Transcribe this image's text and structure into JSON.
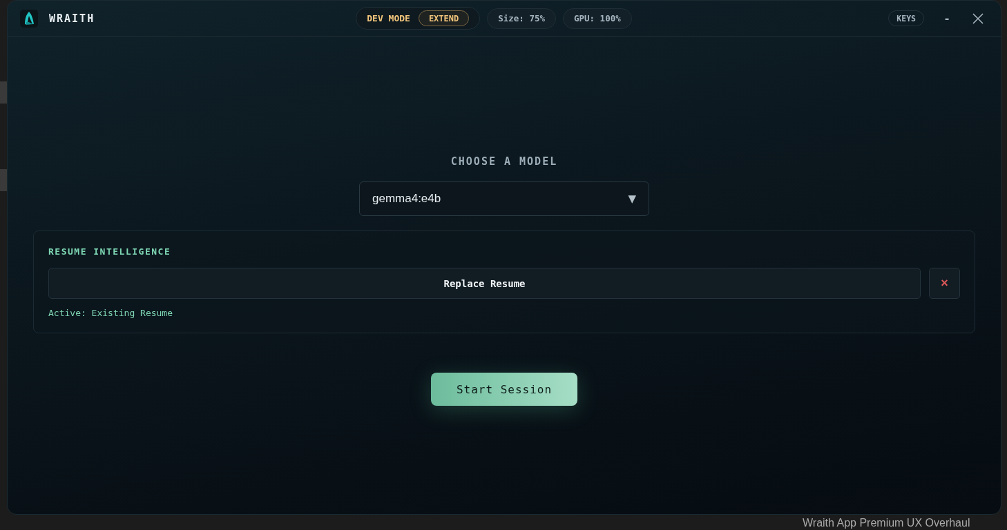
{
  "backdrop": {
    "bottom_title": "Wraith App Premium UX Overhaul"
  },
  "window": {
    "title": "WRAITH",
    "dev_mode": {
      "label": "DEV MODE",
      "button": "EXTEND"
    },
    "stats": [
      "Size: 75%",
      "GPU: 100%"
    ],
    "controls": {
      "keys": "KEYS",
      "minimize": "-"
    }
  },
  "model": {
    "heading": "CHOOSE A MODEL",
    "value": "gemma4:e4b",
    "caret": "▼"
  },
  "resume": {
    "heading": "RESUME INTELLIGENCE",
    "button": "Replace Resume",
    "remove": "×",
    "status": "Active: Existing Resume"
  },
  "start_button": "Start Session"
}
